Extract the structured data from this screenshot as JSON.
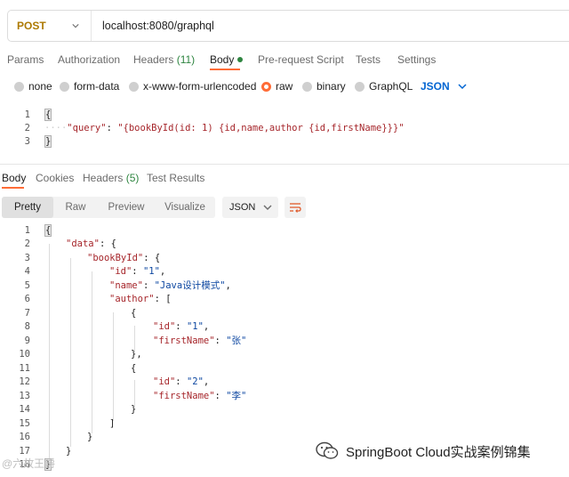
{
  "request": {
    "method": "POST",
    "url": "localhost:8080/graphql"
  },
  "request_tabs": [
    {
      "label": "Params"
    },
    {
      "label": "Authorization"
    },
    {
      "label": "Headers",
      "count": "(11)"
    },
    {
      "label": "Body"
    },
    {
      "label": "Pre-request Script"
    },
    {
      "label": "Tests"
    },
    {
      "label": "Settings"
    }
  ],
  "body_types": [
    "none",
    "form-data",
    "x-www-form-urlencoded",
    "raw",
    "binary",
    "GraphQL"
  ],
  "body_format": "JSON",
  "request_body": {
    "line_numbers": [
      "1",
      "2",
      "3"
    ],
    "open": "{",
    "indent_dots": "····",
    "key": "\"query\"",
    "colon": ": ",
    "value": "\"{bookById(id: 1) {id,name,author {id,firstName}}}\"",
    "close": "}"
  },
  "response_tabs": [
    {
      "label": "Body"
    },
    {
      "label": "Cookies"
    },
    {
      "label": "Headers",
      "count": "(5)"
    },
    {
      "label": "Test Results"
    }
  ],
  "response_views": [
    "Pretty",
    "Raw",
    "Preview",
    "Visualize"
  ],
  "response_format": "JSON",
  "response_body": {
    "line_numbers": [
      "1",
      "2",
      "3",
      "4",
      "5",
      "6",
      "7",
      "8",
      "9",
      "10",
      "11",
      "12",
      "13",
      "14",
      "15",
      "16",
      "17",
      "18"
    ],
    "lines": {
      "l1": "{",
      "l2_key": "\"data\"",
      "l2_rest": ": {",
      "l3_key": "\"bookById\"",
      "l3_rest": ": {",
      "l4_key": "\"id\"",
      "l4_colon": ": ",
      "l4_val": "\"1\"",
      "l4_end": ",",
      "l5_key": "\"name\"",
      "l5_colon": ": ",
      "l5_val": "\"Java设计模式\"",
      "l5_end": ",",
      "l6_key": "\"author\"",
      "l6_rest": ": [",
      "l7": "{",
      "l8_key": "\"id\"",
      "l8_colon": ": ",
      "l8_val": "\"1\"",
      "l8_end": ",",
      "l9_key": "\"firstName\"",
      "l9_colon": ": ",
      "l9_val": "\"张\"",
      "l10": "},",
      "l11": "{",
      "l12_key": "\"id\"",
      "l12_colon": ": ",
      "l12_val": "\"2\"",
      "l12_end": ",",
      "l13_key": "\"firstName\"",
      "l13_colon": ": ",
      "l13_val": "\"李\"",
      "l14": "}",
      "l15": "]",
      "l16": "}",
      "l17": "}",
      "l18": "}"
    }
  },
  "watermark": {
    "channel": "SpringBoot Cloud实战案例锦集",
    "corner": "@六故王爵"
  },
  "colors": {
    "accent": "#ff6c37",
    "method": "#ad7a03",
    "link_blue": "#0265d2",
    "string": "#a6262b",
    "number_blue": "#0d47a1",
    "success_green": "#2e8540"
  }
}
